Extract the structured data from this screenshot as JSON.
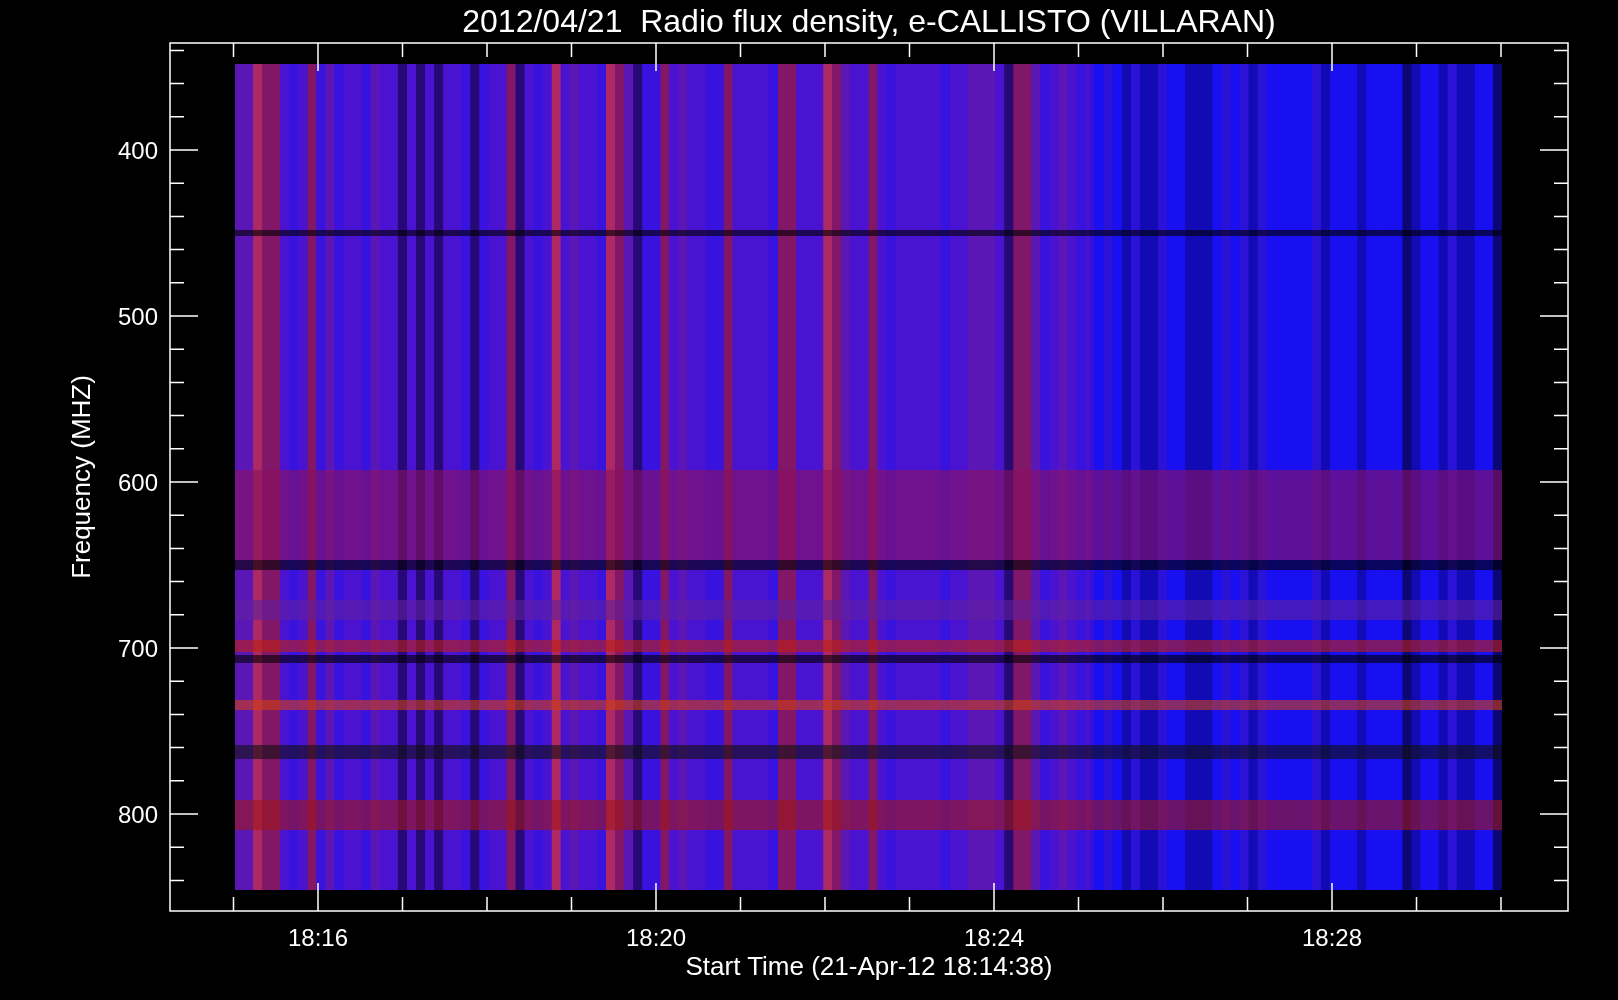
{
  "title": "2012/04/21  Radio flux density, e-CALLISTO (VILLARAN)",
  "y_axis": {
    "label": "Frequency (MHZ)",
    "ticks": [
      "400",
      "500",
      "600",
      "700",
      "800"
    ]
  },
  "x_axis": {
    "label": "Start Time (21-Apr-12 18:14:38)",
    "ticks": [
      "18:16",
      "18:20",
      "18:24",
      "18:28"
    ]
  }
}
